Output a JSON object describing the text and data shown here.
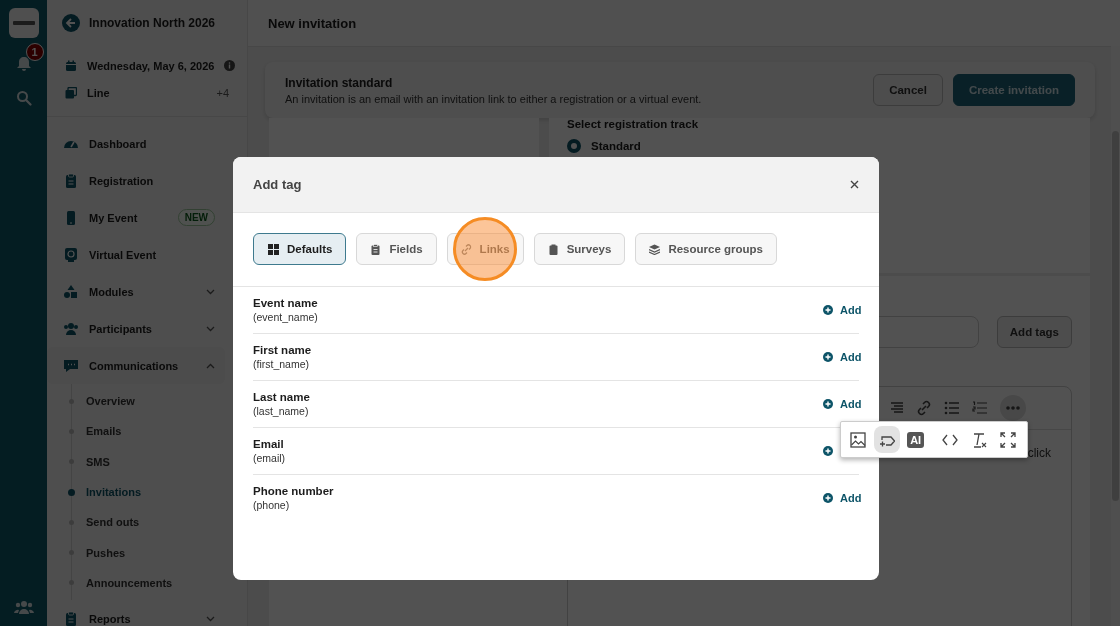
{
  "rail": {
    "notification_count": "1"
  },
  "sidebar": {
    "event_title": "Innovation North 2026",
    "date": "Wednesday, May 6, 2026",
    "line": {
      "label": "Line",
      "count": "+4"
    },
    "nav": [
      {
        "label": "Dashboard"
      },
      {
        "label": "Registration"
      },
      {
        "label": "My Event",
        "badge": "NEW"
      },
      {
        "label": "Virtual Event"
      },
      {
        "label": "Modules",
        "expanded": false
      },
      {
        "label": "Participants",
        "expanded": false
      },
      {
        "label": "Communications",
        "expanded": true,
        "children": [
          {
            "label": "Overview",
            "selected": false
          },
          {
            "label": "Emails",
            "selected": false
          },
          {
            "label": "SMS",
            "selected": false
          },
          {
            "label": "Invitations",
            "selected": true
          },
          {
            "label": "Send outs",
            "selected": false
          },
          {
            "label": "Pushes",
            "selected": false
          },
          {
            "label": "Announcements",
            "selected": false
          }
        ]
      },
      {
        "label": "Reports",
        "expanded": false
      }
    ]
  },
  "main": {
    "title": "New invitation",
    "notice": {
      "title": "Invitation standard",
      "text": "An invitation is an email with an invitation link to either a registration or a virtual event."
    },
    "buttons": [
      {
        "label": "Cancel",
        "kind": "secondary"
      },
      {
        "label": "Create invitation",
        "kind": "primary"
      }
    ],
    "track": {
      "label": "Select registration track",
      "options": [
        {
          "label": "Standard",
          "selected": true
        }
      ]
    },
    "add_tags_button": "Add tags",
    "editor_text": "click"
  },
  "modal": {
    "title": "Add tag",
    "tabs": [
      {
        "label": "Defaults",
        "selected": true,
        "highlighted": false
      },
      {
        "label": "Fields",
        "selected": false,
        "highlighted": false
      },
      {
        "label": "Links",
        "selected": false,
        "highlighted": true
      },
      {
        "label": "Surveys",
        "selected": false,
        "highlighted": false
      },
      {
        "label": "Resource groups",
        "selected": false,
        "highlighted": false
      }
    ],
    "rows": [
      {
        "name": "Event name",
        "key": "(event_name)",
        "add_label": "Add"
      },
      {
        "name": "First name",
        "key": "(first_name)",
        "add_label": "Add"
      },
      {
        "name": "Last name",
        "key": "(last_name)",
        "add_label": "Add"
      },
      {
        "name": "Email",
        "key": "(email)"
      },
      {
        "name": "Phone number",
        "key": "(phone)",
        "add_label": "Add"
      }
    ]
  },
  "popover": {
    "tools": [
      {
        "kind": "image",
        "selected": false
      },
      {
        "kind": "tag",
        "selected": true
      },
      {
        "kind": "ai",
        "label": "AI",
        "selected": false
      },
      {
        "kind": "code",
        "selected": false
      },
      {
        "kind": "clear-format",
        "selected": false
      },
      {
        "kind": "fullscreen",
        "selected": false
      }
    ]
  }
}
